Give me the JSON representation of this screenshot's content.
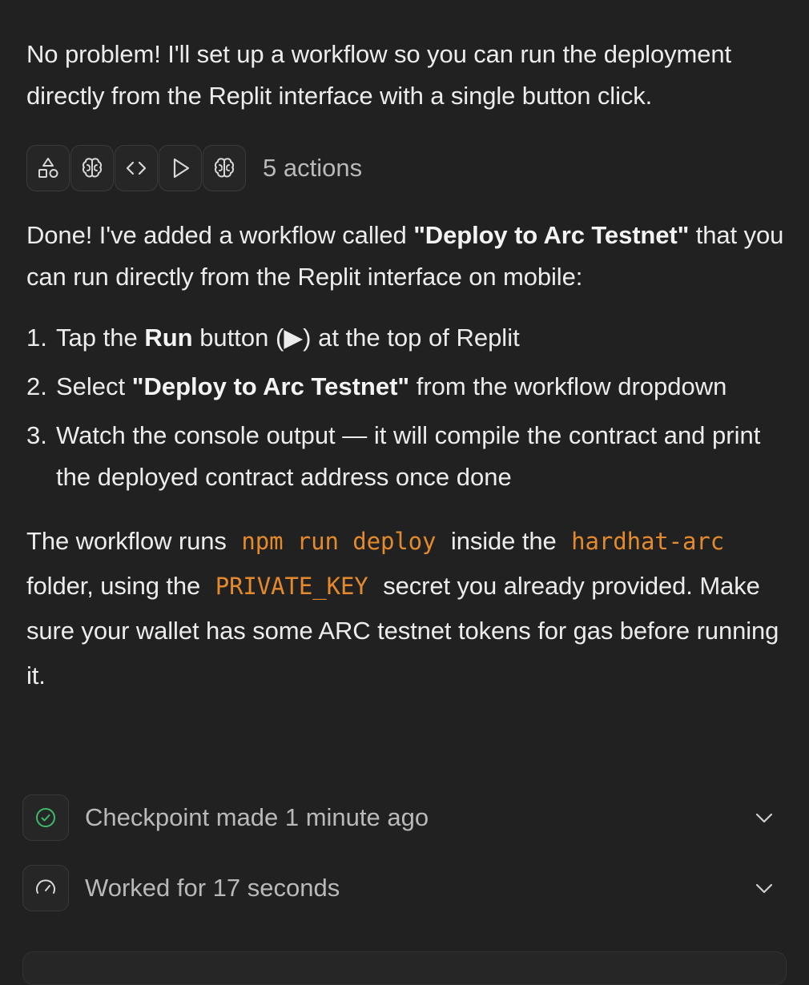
{
  "message": {
    "intro": "No problem! I'll set up a workflow so you can run the deployment directly from the Replit interface with a single button click.",
    "actions": {
      "icons": [
        "shapes-icon",
        "brain-icon",
        "code-icon",
        "play-icon",
        "brain-icon"
      ],
      "count_label": "5 actions"
    },
    "done": {
      "prefix": "Done! I've added a workflow called ",
      "workflow_name": "\"Deploy to Arc Testnet\"",
      "suffix": " that you can run directly from the Replit interface on mobile:"
    },
    "steps": [
      {
        "num": "1.",
        "a": "Tap the ",
        "bold": "Run",
        "b": " button (▶) at the top of Replit"
      },
      {
        "num": "2.",
        "a": "Select ",
        "bold": "\"Deploy to Arc Testnet\"",
        "b": " from the workflow dropdown"
      },
      {
        "num": "3.",
        "a": "Watch the console output — it will compile the contract and print the deployed contract address once done",
        "bold": "",
        "b": ""
      }
    ],
    "outro": {
      "t1": "The workflow runs",
      "code1": "npm run deploy",
      "t2": "inside the",
      "code2": "hardhat-arc",
      "t3": "folder, using the",
      "code3": "PRIVATE_KEY",
      "t4": "secret you already provided. Make sure your wallet has some ARC testnet tokens for gas before running it."
    }
  },
  "status": {
    "checkpoint_label": "Checkpoint made 1 minute ago",
    "worked_label": "Worked for 17 seconds"
  },
  "colors": {
    "background": "#212121",
    "text": "#ececec",
    "muted": "#b9b9b9",
    "code": "#e58a2c",
    "checkpoint_green": "#3fb96b"
  }
}
